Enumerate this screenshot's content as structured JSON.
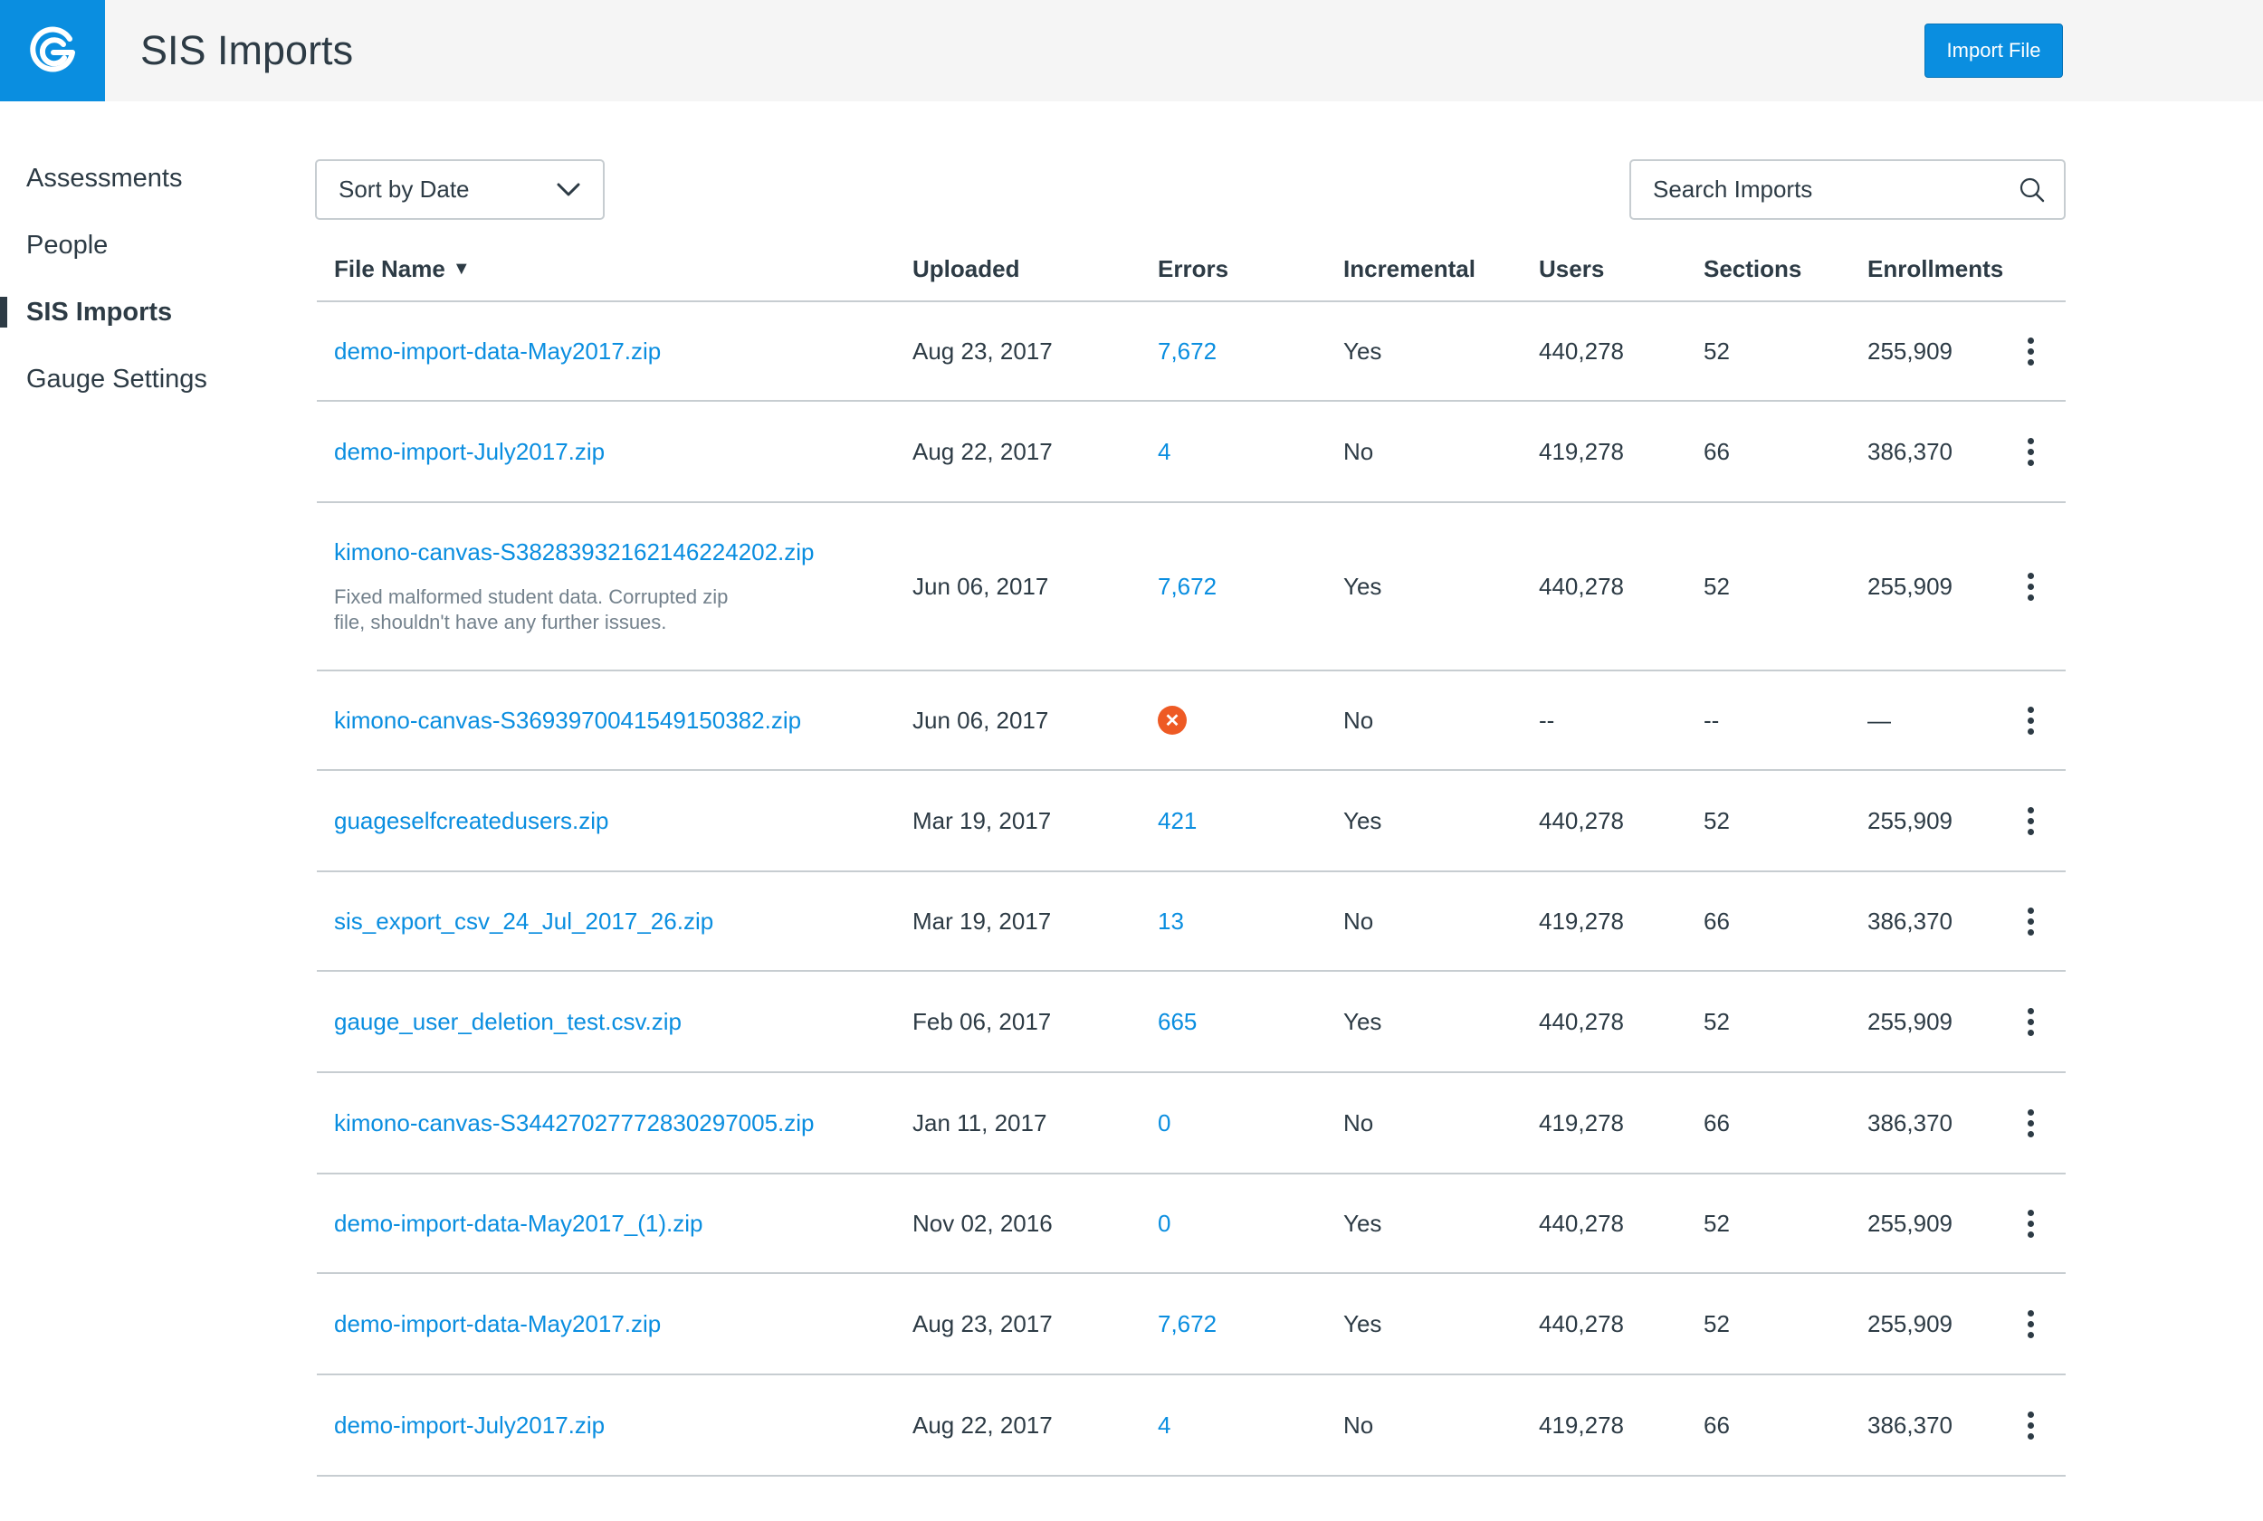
{
  "header": {
    "title": "SIS Imports",
    "import_button": "Import File",
    "brand_color": "#0A8EE0"
  },
  "sidebar": {
    "items": [
      {
        "label": "Assessments",
        "active": false
      },
      {
        "label": "People",
        "active": false
      },
      {
        "label": "SIS Imports",
        "active": true
      },
      {
        "label": "Gauge Settings",
        "active": false
      }
    ]
  },
  "toolbar": {
    "sort_value": "Sort by Date",
    "search_placeholder": "Search Imports",
    "search_value": ""
  },
  "table": {
    "columns": [
      "File Name",
      "Uploaded",
      "Errors",
      "Incremental",
      "Users",
      "Sections",
      "Enrollments"
    ],
    "sorted_column": "File Name",
    "rows": [
      {
        "file": "demo-import-data-May2017.zip",
        "note": "",
        "uploaded": "Aug 23, 2017",
        "errors": "7,672",
        "error_icon": false,
        "incremental": "Yes",
        "users": "440,278",
        "sections": "52",
        "enrollments": "255,909"
      },
      {
        "file": "demo-import-July2017.zip",
        "note": "",
        "uploaded": "Aug 22, 2017",
        "errors": "4",
        "error_icon": false,
        "incremental": "No",
        "users": "419,278",
        "sections": "66",
        "enrollments": "386,370"
      },
      {
        "file": "kimono-canvas-S38283932162146224202.zip",
        "note": "Fixed malformed student data. Corrupted zip file, shouldn't have any further issues.",
        "uploaded": "Jun 06, 2017",
        "errors": "7,672",
        "error_icon": false,
        "incremental": "Yes",
        "users": "440,278",
        "sections": "52",
        "enrollments": "255,909"
      },
      {
        "file": "kimono-canvas-S3693970041549150382.zip",
        "note": "",
        "uploaded": "Jun 06, 2017",
        "errors": "",
        "error_icon": true,
        "incremental": "No",
        "users": "--",
        "sections": "--",
        "enrollments": "—"
      },
      {
        "file": "guageselfcreatedusers.zip",
        "note": "",
        "uploaded": "Mar 19, 2017",
        "errors": "421",
        "error_icon": false,
        "incremental": "Yes",
        "users": "440,278",
        "sections": "52",
        "enrollments": "255,909"
      },
      {
        "file": "sis_export_csv_24_Jul_2017_26.zip",
        "note": "",
        "uploaded": "Mar 19, 2017",
        "errors": "13",
        "error_icon": false,
        "incremental": "No",
        "users": "419,278",
        "sections": "66",
        "enrollments": "386,370"
      },
      {
        "file": "gauge_user_deletion_test.csv.zip",
        "note": "",
        "uploaded": "Feb 06, 2017",
        "errors": "665",
        "error_icon": false,
        "incremental": "Yes",
        "users": "440,278",
        "sections": "52",
        "enrollments": "255,909"
      },
      {
        "file": "kimono-canvas-S34427027772830297005.zip",
        "note": "",
        "uploaded": "Jan 11, 2017",
        "errors": "0",
        "error_icon": false,
        "incremental": "No",
        "users": "419,278",
        "sections": "66",
        "enrollments": "386,370"
      },
      {
        "file": "demo-import-data-May2017_(1).zip",
        "note": "",
        "uploaded": "Nov 02, 2016",
        "errors": "0",
        "error_icon": false,
        "incremental": "Yes",
        "users": "440,278",
        "sections": "52",
        "enrollments": "255,909"
      },
      {
        "file": "demo-import-data-May2017.zip",
        "note": "",
        "uploaded": "Aug 23, 2017",
        "errors": "7,672",
        "error_icon": false,
        "incremental": "Yes",
        "users": "440,278",
        "sections": "52",
        "enrollments": "255,909"
      },
      {
        "file": "demo-import-July2017.zip",
        "note": "",
        "uploaded": "Aug 22, 2017",
        "errors": "4",
        "error_icon": false,
        "incremental": "No",
        "users": "419,278",
        "sections": "66",
        "enrollments": "386,370"
      }
    ]
  }
}
